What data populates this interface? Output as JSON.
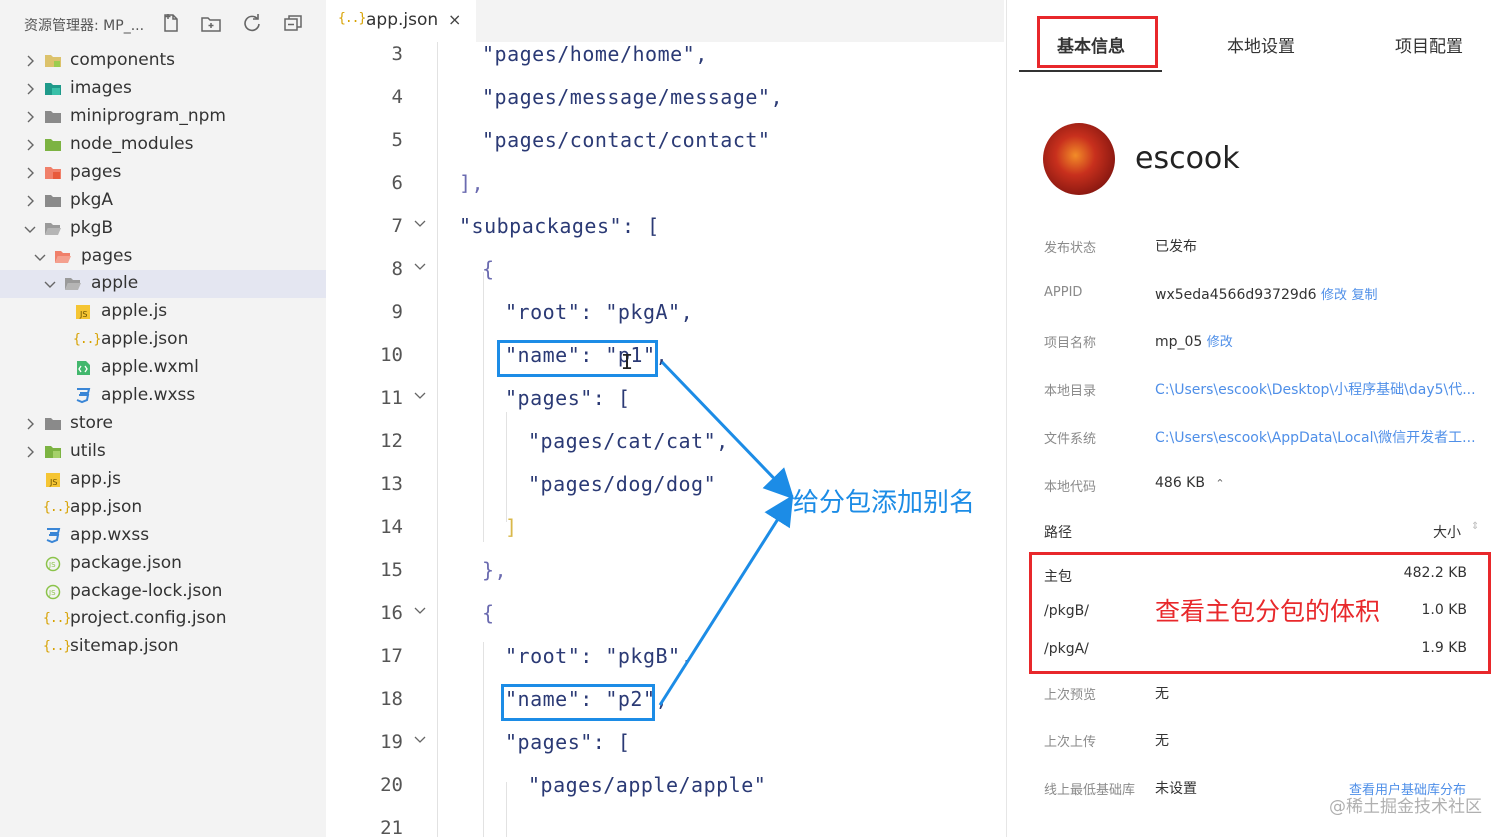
{
  "explorer": {
    "title": "资源管理器: MP_...",
    "items": [
      {
        "label": "components"
      },
      {
        "label": "images"
      },
      {
        "label": "miniprogram_npm"
      },
      {
        "label": "node_modules"
      },
      {
        "label": "pages"
      },
      {
        "label": "pkgA"
      },
      {
        "label": "pkgB"
      },
      {
        "label": "pages"
      },
      {
        "label": "apple"
      },
      {
        "label": "apple.js"
      },
      {
        "label": "apple.json"
      },
      {
        "label": "apple.wxml"
      },
      {
        "label": "apple.wxss"
      },
      {
        "label": "store"
      },
      {
        "label": "utils"
      },
      {
        "label": "app.js"
      },
      {
        "label": "app.json"
      },
      {
        "label": "app.wxss"
      },
      {
        "label": "package.json"
      },
      {
        "label": "package-lock.json"
      },
      {
        "label": "project.config.json"
      },
      {
        "label": "sitemap.json"
      }
    ]
  },
  "editor": {
    "tab": {
      "icon": "{..}",
      "label": "app.json",
      "close": "×"
    },
    "lines": [
      {
        "n": "3",
        "text": "\"pages/home/home\","
      },
      {
        "n": "4",
        "text": "\"pages/message/message\","
      },
      {
        "n": "5",
        "text": "\"pages/contact/contact\""
      },
      {
        "n": "6",
        "text": "],"
      },
      {
        "n": "7",
        "text": "\"subpackages\": ["
      },
      {
        "n": "8",
        "text": "{"
      },
      {
        "n": "9",
        "text": "\"root\": \"pkgA\","
      },
      {
        "n": "10",
        "text": "\"name\": \"p1\","
      },
      {
        "n": "11",
        "text": "\"pages\": ["
      },
      {
        "n": "12",
        "text": "\"pages/cat/cat\","
      },
      {
        "n": "13",
        "text": "\"pages/dog/dog\""
      },
      {
        "n": "14",
        "text": "]"
      },
      {
        "n": "15",
        "text": "},"
      },
      {
        "n": "16",
        "text": "{"
      },
      {
        "n": "17",
        "text": "\"root\": \"pkgB\","
      },
      {
        "n": "18",
        "text": "\"name\": \"p2\","
      },
      {
        "n": "19",
        "text": "\"pages\": ["
      },
      {
        "n": "20",
        "text": "\"pages/apple/apple\""
      },
      {
        "n": "21",
        "text": ""
      }
    ],
    "annotation": "给分包添加别名"
  },
  "panel": {
    "tabs": [
      "基本信息",
      "本地设置",
      "项目配置"
    ],
    "username": "escook",
    "rows": [
      {
        "label": "发布状态",
        "value": "已发布"
      },
      {
        "label": "APPID",
        "value": "wx5eda4566d93729d6",
        "links": [
          "修改",
          "复制"
        ]
      },
      {
        "label": "项目名称",
        "value": "mp_05",
        "links": [
          "修改"
        ]
      },
      {
        "label": "本地目录",
        "value": "C:\\Users\\escook\\Desktop\\小程序基础\\day5\\代..."
      },
      {
        "label": "文件系统",
        "value": "C:\\Users\\escook\\AppData\\Local\\微信开发者工..."
      },
      {
        "label": "本地代码",
        "value": "486 KB",
        "extra": "⌃"
      }
    ],
    "path_header": "路径",
    "size_header": "大小",
    "size_sort": "⇕",
    "packages": [
      {
        "name": "主包",
        "size": "482.2 KB"
      },
      {
        "name": "/pkgB/",
        "size": "1.0 KB"
      },
      {
        "name": "/pkgA/",
        "size": "1.9 KB"
      }
    ],
    "annotation": "查看主包分包的体积",
    "rows2": [
      {
        "label": "上次预览",
        "value": "无"
      },
      {
        "label": "上次上传",
        "value": "无"
      },
      {
        "label": "线上最低基础库",
        "value": "未设置",
        "link": "查看用户基础库分布"
      }
    ],
    "watermark": "@稀土掘金技术社区"
  }
}
